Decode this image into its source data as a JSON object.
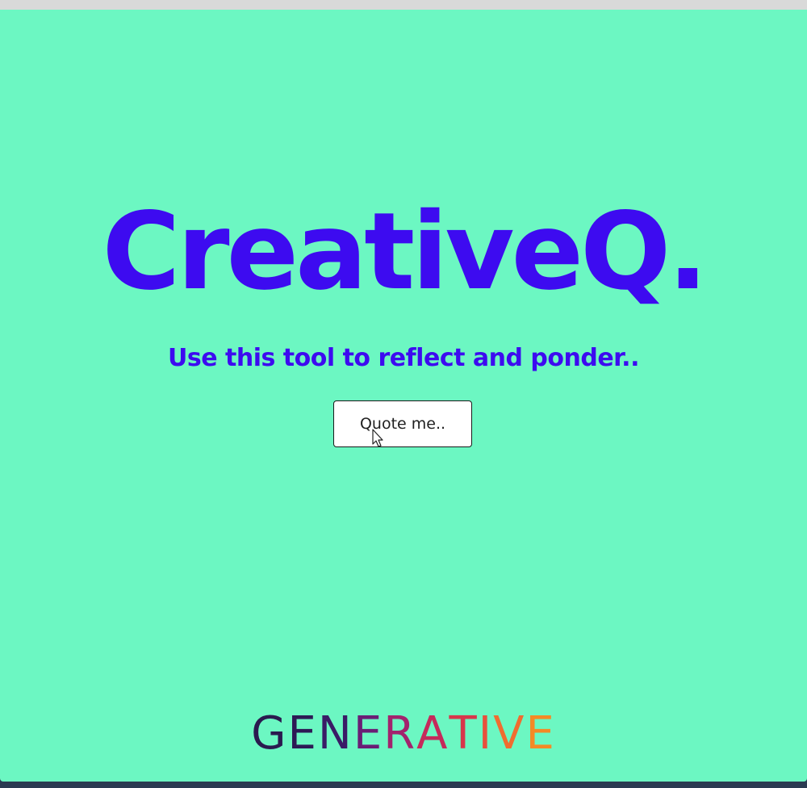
{
  "app": {
    "title": "CreativeQ.",
    "subtitle": "Use this tool to reflect and ponder..",
    "quote_button_label": "Quote me.."
  },
  "brand": {
    "name": "GENERATIVE",
    "letter_colors": [
      "#2a1a4f",
      "#2d1a55",
      "#3a1b66",
      "#6a1e75",
      "#a2236d",
      "#c52a5b",
      "#d8364b",
      "#e8503c",
      "#f06c30",
      "#f48a26"
    ]
  },
  "colors": {
    "background": "#6cf7c2",
    "accent": "#3d0bf0",
    "button_bg": "#ffffff"
  },
  "icons": {
    "cursor": "mouse-pointer-icon"
  }
}
